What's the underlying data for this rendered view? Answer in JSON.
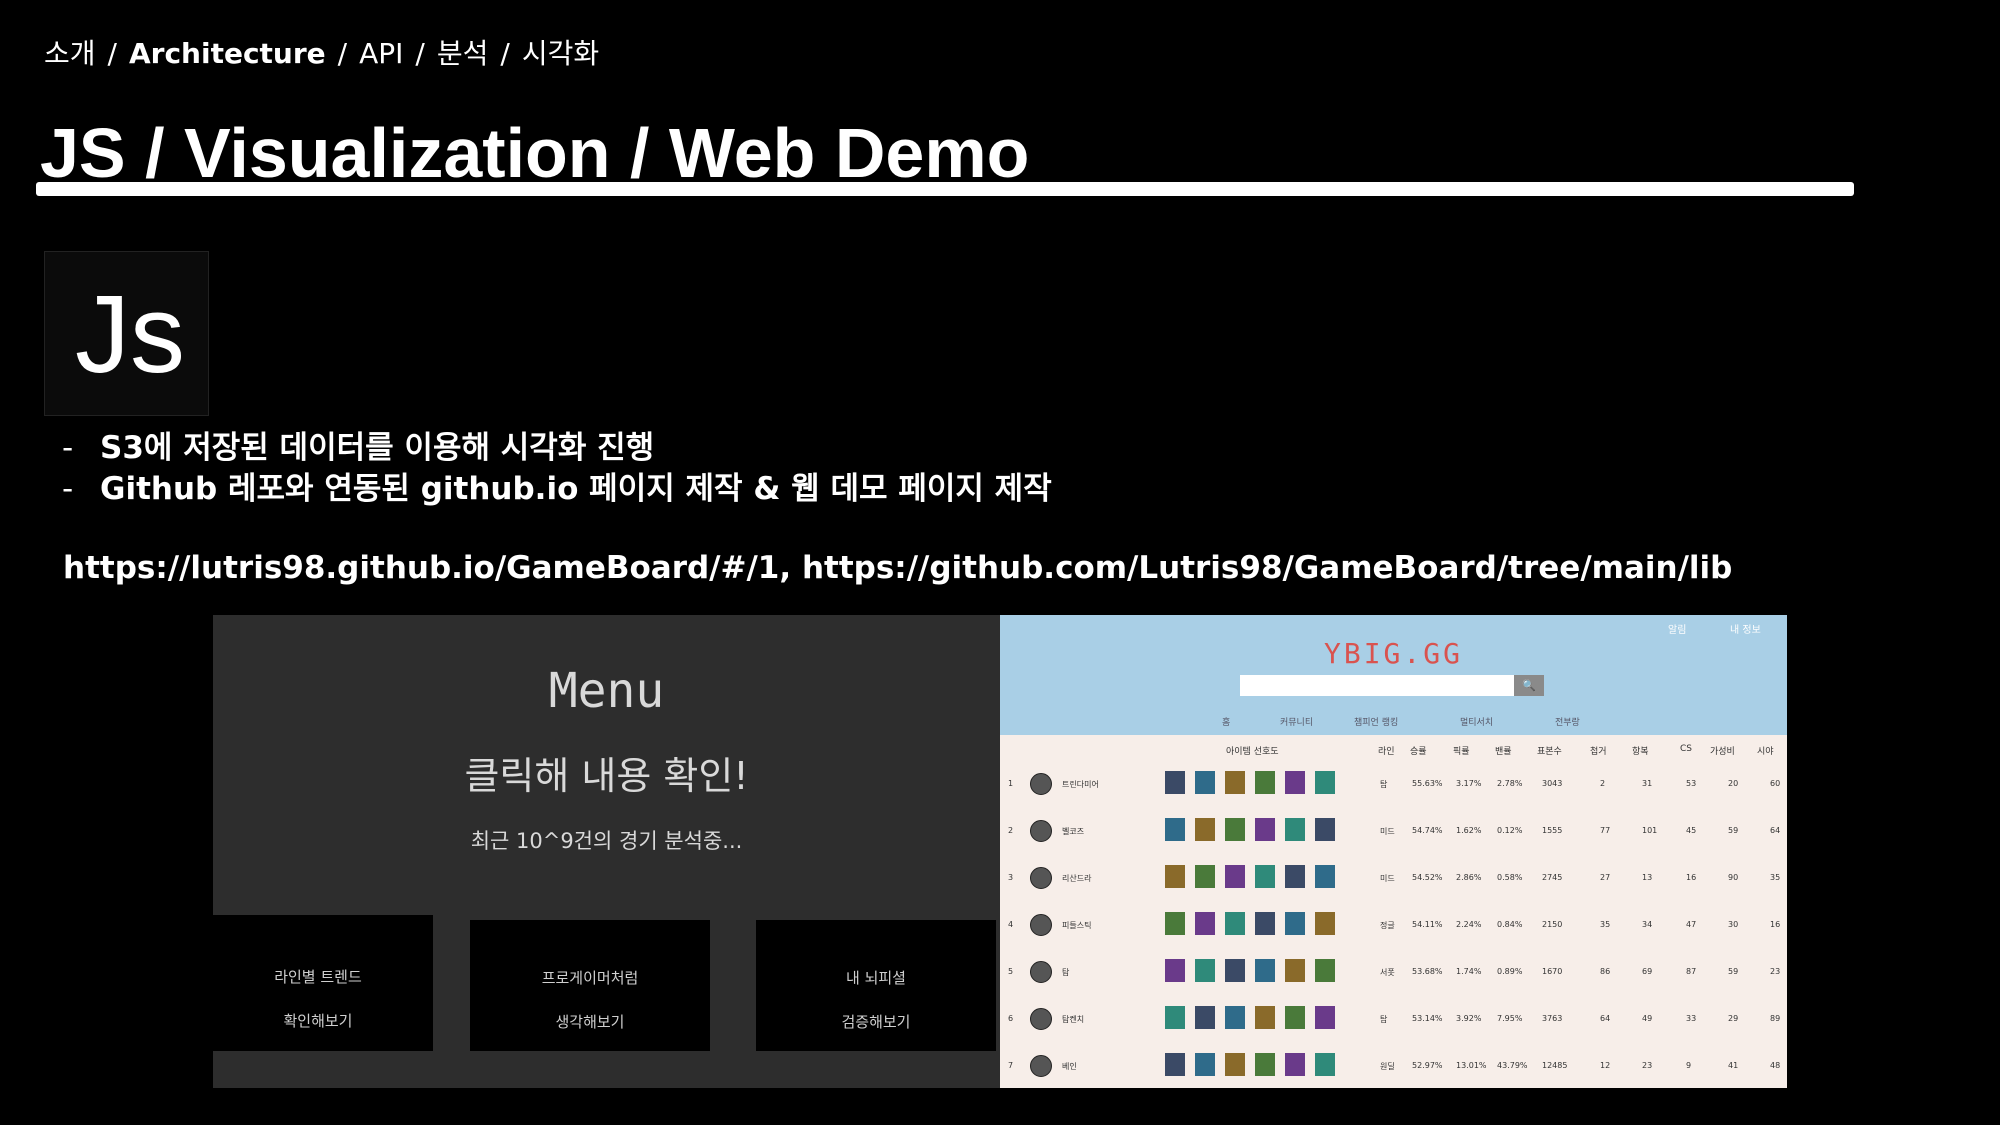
{
  "breadcrumb": [
    "소개",
    "Architecture",
    "API",
    "분석",
    "시각화"
  ],
  "breadcrumb_active": "Architecture",
  "title": "JS / Visualization / Web Demo",
  "logo_text": "Js",
  "bullets": [
    "S3에 저장된 데이터를 이용해 시각화 진행",
    "Github 레포와 연동된 github.io 페이지 제작 & 웹 데모 페이지 제작"
  ],
  "bullet_dash": "-",
  "links": "https://lutris98.github.io/GameBoard/#/1, https://github.com/Lutris98/GameBoard/tree/main/lib",
  "menu": {
    "title": "Menu",
    "subtitle": "클릭해 내용 확인!",
    "note": "최근 10^9건의 경기 분석중...",
    "cards": [
      {
        "line1": "라인별 트렌드",
        "line2": "확인해보기"
      },
      {
        "line1": "프로게이머처럼",
        "line2": "생각해보기"
      },
      {
        "line1": "내 뇌피셜",
        "line2": "검증해보기"
      }
    ]
  },
  "ybig": {
    "logo": "YBIG.GG",
    "search_button": "🔍",
    "user_links": [
      "알림",
      "내 정보"
    ],
    "nav": [
      "홈",
      "커뮤니티",
      "챔피언 랭킹",
      "멀티서치",
      "전부랑"
    ],
    "headers": [
      "아이템 선호도",
      "라인",
      "승률",
      "픽률",
      "밴률",
      "표본수",
      "첩거",
      "항복",
      "CS",
      "가성비",
      "시야"
    ],
    "rows": [
      {
        "rank": "1",
        "name": "트린다미어",
        "lane": "탑",
        "win": "55.63%",
        "pick": "3.17%",
        "ban": "2.78%",
        "samples": "3043",
        "a": "2",
        "b": "31",
        "cs": "53",
        "value": "20",
        "vision": "60"
      },
      {
        "rank": "2",
        "name": "벨코즈",
        "lane": "미드",
        "win": "54.74%",
        "pick": "1.62%",
        "ban": "0.12%",
        "samples": "1555",
        "a": "77",
        "b": "101",
        "cs": "45",
        "value": "59",
        "vision": "64"
      },
      {
        "rank": "3",
        "name": "리산드라",
        "lane": "미드",
        "win": "54.52%",
        "pick": "2.86%",
        "ban": "0.58%",
        "samples": "2745",
        "a": "27",
        "b": "13",
        "cs": "16",
        "value": "90",
        "vision": "35"
      },
      {
        "rank": "4",
        "name": "피들스틱",
        "lane": "정글",
        "win": "54.11%",
        "pick": "2.24%",
        "ban": "0.84%",
        "samples": "2150",
        "a": "35",
        "b": "34",
        "cs": "47",
        "value": "30",
        "vision": "16"
      },
      {
        "rank": "5",
        "name": "탐",
        "lane": "서폿",
        "win": "53.68%",
        "pick": "1.74%",
        "ban": "0.89%",
        "samples": "1670",
        "a": "86",
        "b": "69",
        "cs": "87",
        "value": "59",
        "vision": "23"
      },
      {
        "rank": "6",
        "name": "탐켄치",
        "lane": "탑",
        "win": "53.14%",
        "pick": "3.92%",
        "ban": "7.95%",
        "samples": "3763",
        "a": "64",
        "b": "49",
        "cs": "33",
        "value": "29",
        "vision": "89"
      },
      {
        "rank": "7",
        "name": "베인",
        "lane": "원딜",
        "win": "52.97%",
        "pick": "13.01%",
        "ban": "43.79%",
        "samples": "12485",
        "a": "12",
        "b": "23",
        "cs": "9",
        "value": "41",
        "vision": "48"
      }
    ],
    "item_colors": [
      "#3b4a66",
      "#2f6b8a",
      "#8a6a2a",
      "#4a7a3a",
      "#6a3a8a",
      "#2f8a7a"
    ]
  }
}
